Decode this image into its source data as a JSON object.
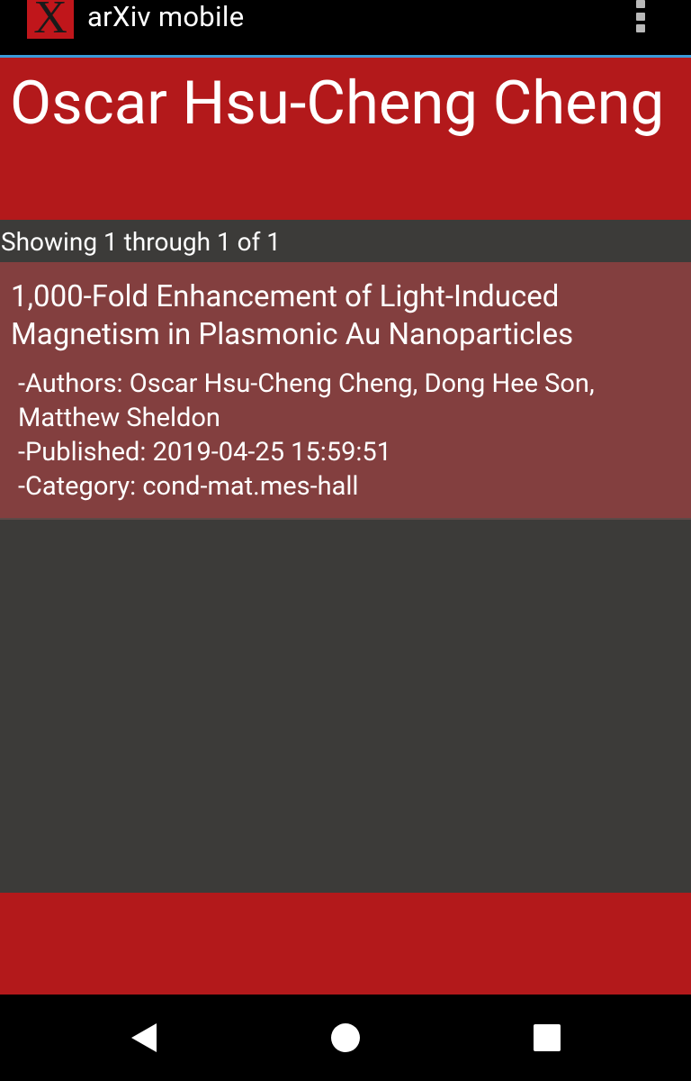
{
  "app": {
    "logo_letter": "X",
    "title": "arXiv mobile",
    "overflow_icon": "more-vert-icon"
  },
  "colors": {
    "appbar": "#000000",
    "appbar_divider": "#3a9ad9",
    "brand_red": "#b3191b",
    "card_bg": "#833f3f",
    "page_bg": "#3c3b39"
  },
  "header": {
    "author_name": "Oscar Hsu-Cheng Cheng"
  },
  "results": {
    "showing_text": "Showing 1 through 1 of 1",
    "items": [
      {
        "title": "1,000-Fold Enhancement of Light-Induced Magnetism in Plasmonic Au Nanoparticles",
        "authors": "-Authors: Oscar Hsu-Cheng Cheng, Dong Hee Son, Matthew Sheldon",
        "published": "-Published: 2019-04-25 15:59:51",
        "category": "-Category: cond-mat.mes-hall"
      }
    ]
  },
  "navbar": {
    "back_icon": "back-triangle-icon",
    "home_icon": "home-circle-icon",
    "recents_icon": "recents-square-icon"
  }
}
